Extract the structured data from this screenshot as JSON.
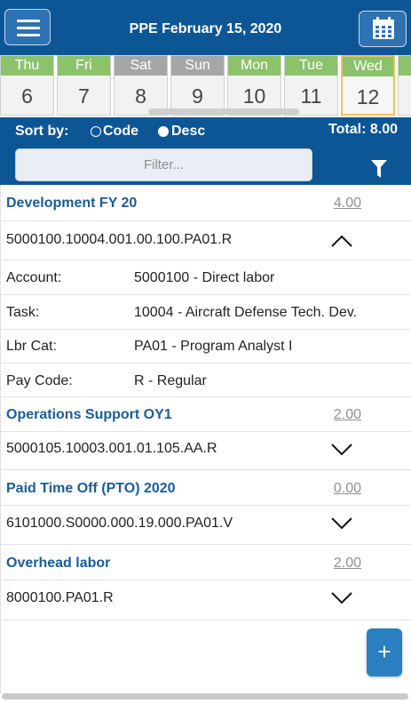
{
  "header": {
    "title": "PPE February 15, 2020",
    "menu_icon": "hamburger-icon",
    "calendar_icon": "calendar-icon"
  },
  "days": [
    {
      "name": "Thu",
      "num": "6",
      "type": "weekday"
    },
    {
      "name": "Fri",
      "num": "7",
      "type": "weekday"
    },
    {
      "name": "Sat",
      "num": "8",
      "type": "weekend"
    },
    {
      "name": "Sun",
      "num": "9",
      "type": "weekend"
    },
    {
      "name": "Mon",
      "num": "10",
      "type": "weekday"
    },
    {
      "name": "Tue",
      "num": "11",
      "type": "weekday"
    },
    {
      "name": "Wed",
      "num": "12",
      "type": "weekday",
      "selected": true
    }
  ],
  "sort": {
    "label": "Sort by:",
    "option_code": "Code",
    "option_desc": "Desc",
    "selected": "Code"
  },
  "total": "Total: 8.00",
  "filter": {
    "placeholder": "Filter...",
    "icon": "funnel-icon"
  },
  "entries": [
    {
      "project": "Development FY 20",
      "hours": "4.00",
      "code": "5000100.10004.001.00.100.PA01.R",
      "expanded": true,
      "details": [
        {
          "label": "Account:",
          "value": "5000100 - Direct labor"
        },
        {
          "label": "Task:",
          "value": "10004 - Aircraft Defense Tech. Dev."
        },
        {
          "label": "Lbr Cat:",
          "value": "PA01 - Program Analyst I"
        },
        {
          "label": "Pay Code:",
          "value": "R - Regular"
        }
      ]
    },
    {
      "project": "Operations Support OY1",
      "hours": "2.00",
      "code": "5000105.10003.001.01.105.AA.R",
      "expanded": false
    },
    {
      "project": "Paid Time Off (PTO) 2020",
      "hours": "0.00",
      "code": "6101000.S0000.000.19.000.PA01.V",
      "expanded": false
    },
    {
      "project": "Overhead labor",
      "hours": "2.00",
      "code": "8000100.PA01.R",
      "expanded": false
    }
  ],
  "fab": {
    "label": "+"
  },
  "colors": {
    "header_blue": "#0d5696",
    "project_blue": "#1b5c96",
    "weekday_green": "#8cc26b",
    "weekend_gray": "#a6a6a6",
    "selected_border": "#f0c15a",
    "fab_blue": "#2a7fc0"
  }
}
